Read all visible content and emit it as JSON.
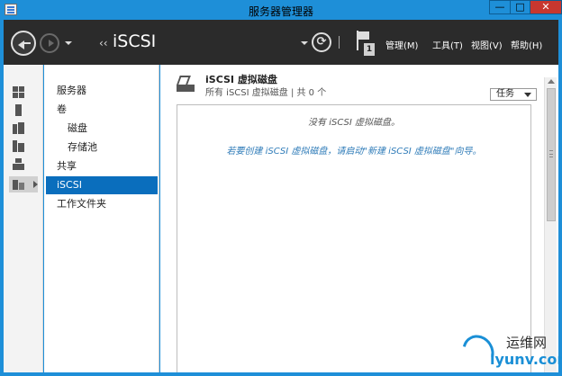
{
  "window": {
    "title": "服务器管理器",
    "min_label": "—",
    "max_label": "□",
    "close_label": "✕"
  },
  "header": {
    "crumb_sep": "‹‹",
    "crumb_title": "iSCSI",
    "refresh_glyph": "⟳",
    "notification_count": "1",
    "menus": {
      "manage": "管理(M)",
      "tools": "工具(T)",
      "view": "视图(V)",
      "help": "帮助(H)"
    }
  },
  "rail": {
    "icons": [
      "dashboard-icon",
      "local-server-icon",
      "all-servers-icon",
      "file-services-icon",
      "iis-icon",
      "storage-services-icon"
    ]
  },
  "nav": {
    "items": [
      {
        "label": "服务器",
        "level": 0,
        "active": false
      },
      {
        "label": "卷",
        "level": 0,
        "active": false
      },
      {
        "label": "磁盘",
        "level": 1,
        "active": false
      },
      {
        "label": "存储池",
        "level": 1,
        "active": false
      },
      {
        "label": "共享",
        "level": 0,
        "active": false
      },
      {
        "label": "iSCSI",
        "level": 0,
        "active": true
      },
      {
        "label": "工作文件夹",
        "level": 0,
        "active": false
      }
    ]
  },
  "tile": {
    "title": "iSCSI 虚拟磁盘",
    "subtitle": "所有 iSCSI 虚拟磁盘 | 共 0 个",
    "tasks_label": "任务",
    "empty_message": "没有 iSCSI 虚拟磁盘。",
    "hint_message": "若要创建 iSCSI 虚拟磁盘，请启动\"新建 iSCSI 虚拟磁盘\"向导。"
  },
  "watermark": {
    "cn": "运维网",
    "en": "iyunv.com"
  },
  "colors": {
    "titlebar": "#1e8fd8",
    "header": "#2b2b2b",
    "nav_active": "#0a6ebd",
    "hint_text": "#2e7bb8",
    "close": "#c7372f"
  }
}
